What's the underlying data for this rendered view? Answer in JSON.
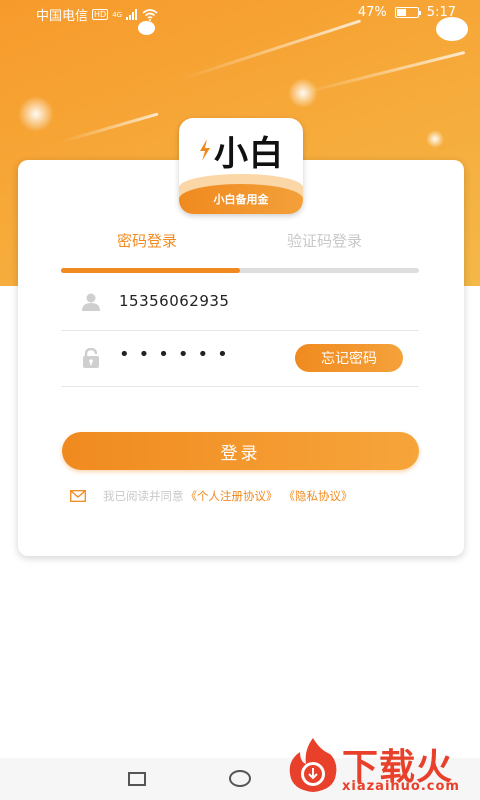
{
  "status_bar": {
    "carrier": "中国电信",
    "hd_badge": "HD",
    "network_badge": "4G",
    "battery_percent": "47%",
    "battery_level": 0.47,
    "time": "5:17"
  },
  "logo": {
    "name": "小白",
    "subtitle": "小白备用金"
  },
  "tabs": [
    {
      "label": "密码登录",
      "active": true
    },
    {
      "label": "验证码登录",
      "active": false
    }
  ],
  "tab_indicator_fraction": 0.5,
  "form": {
    "phone_value": "15356062935",
    "password_value": "••••••",
    "forgot_label": "忘记密码",
    "login_label": "登录"
  },
  "agreement": {
    "text": "我已阅读并同意",
    "link_register": "《个人注册协议》",
    "link_privacy": "《隐私协议》"
  },
  "watermark": {
    "title": "下载火",
    "domain": "xiazaihuo.com"
  },
  "colors": {
    "accent": "#f08a1f",
    "inactive_text": "#c8c8c8",
    "watermark_red": "#e8402a"
  }
}
